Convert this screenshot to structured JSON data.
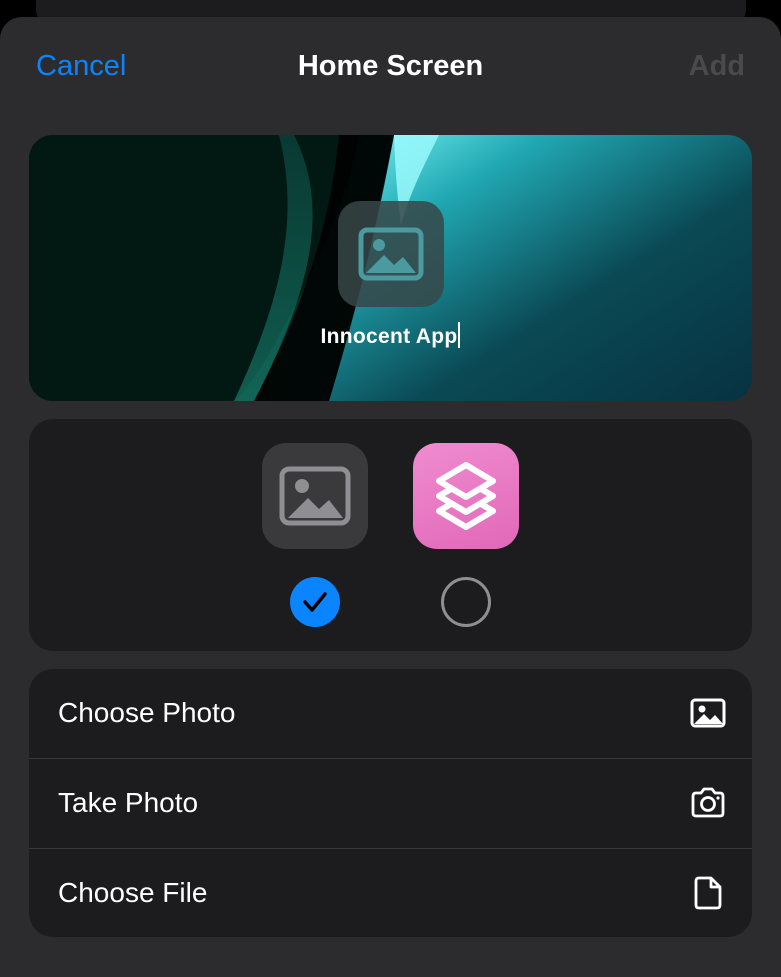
{
  "nav": {
    "cancel_label": "Cancel",
    "title": "Home Screen",
    "add_label": "Add"
  },
  "preview": {
    "app_name": "Innocent App",
    "icon": "photo-icon"
  },
  "icon_choices": [
    {
      "icon": "photo-icon",
      "selected": true
    },
    {
      "icon": "shortcuts-icon",
      "selected": false
    }
  ],
  "options": [
    {
      "label": "Choose Photo",
      "icon": "photo-icon"
    },
    {
      "label": "Take Photo",
      "icon": "camera-icon"
    },
    {
      "label": "Choose File",
      "icon": "document-icon"
    }
  ],
  "colors": {
    "accent": "#0a84ff",
    "sheet_bg": "#2c2c2e",
    "group_bg": "#1c1c1e",
    "shortcuts_pink": "#e56fbf"
  }
}
